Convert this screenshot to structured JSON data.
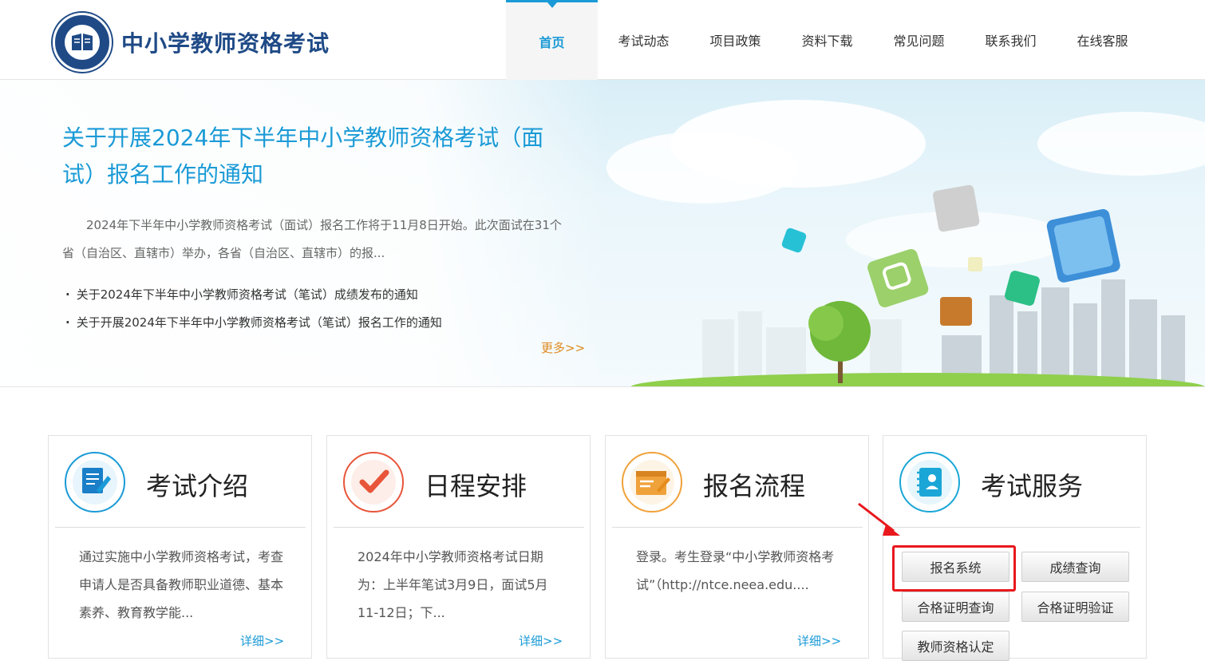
{
  "header": {
    "logo_text": "中小学教师资格考试",
    "nav": [
      "首页",
      "考试动态",
      "项目政策",
      "资料下载",
      "常见问题",
      "联系我们",
      "在线客服"
    ]
  },
  "banner": {
    "title": "关于开展2024年下半年中小学教师资格考试（面试）报名工作的通知",
    "desc": "2024年下半年中小学教师资格考试（面试）报名工作将于11月8日开始。此次面试在31个省（自治区、直辖市）举办，各省（自治区、直辖市）的报...",
    "links": [
      "关于2024年下半年中小学教师资格考试（笔试）成绩发布的通知",
      "关于开展2024年下半年中小学教师资格考试（笔试）报名工作的通知"
    ],
    "more": "更多>>"
  },
  "cards": [
    {
      "title": "考试介绍",
      "text": "通过实施中小学教师资格考试，考查申请人是否具备教师职业道德、基本素养、教育教学能...",
      "more": "详细>>"
    },
    {
      "title": "日程安排",
      "text": "2024年中小学教师资格考试日期为：上半年笔试3月9日，面试5月11-12日；下...",
      "more": "详细>>"
    },
    {
      "title": "报名流程",
      "text": "登录。考生登录“中小学教师资格考试”（http://ntce.neea.edu....",
      "more": "详细>>"
    },
    {
      "title": "考试服务"
    }
  ],
  "services": [
    "报名系统",
    "成绩查询",
    "合格证明查询",
    "合格证明验证",
    "教师资格认定"
  ],
  "colors": {
    "accent": "#1a9ad6",
    "logo": "#1f4a86",
    "more": "#e08a1e",
    "highlight": "#e8181d"
  }
}
